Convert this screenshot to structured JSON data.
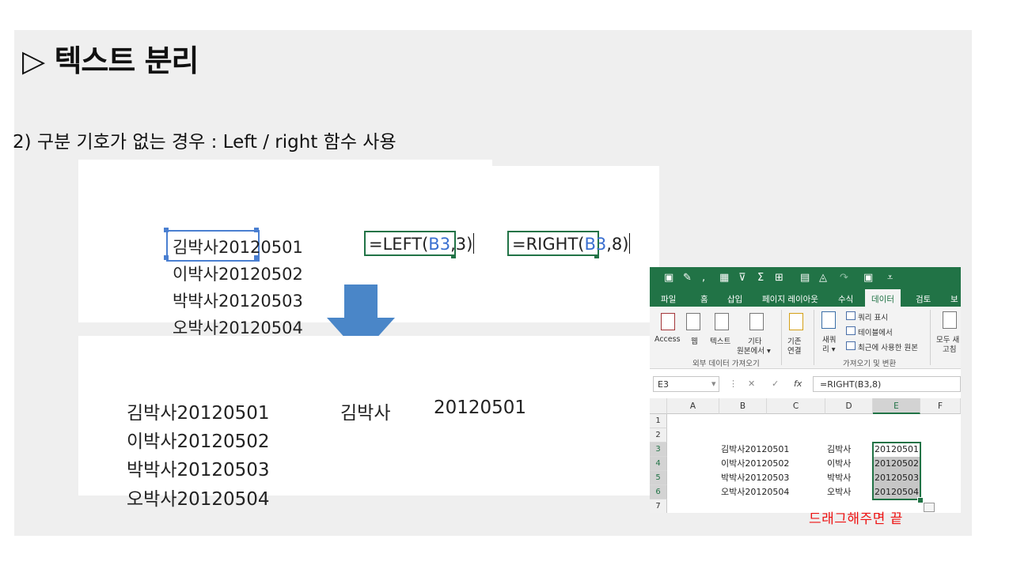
{
  "slide": {
    "title": "▷ 텍스트 분리",
    "subtitle": "2) 구분 기호가 없는 경우 : Left / right 함수 사용"
  },
  "top_panel": {
    "names": [
      "김박사20120501",
      "이박사20120502",
      "박박사20120503",
      "오박사20120504"
    ],
    "left_formula": {
      "prefix": "=LEFT(",
      "ref": "B3",
      "suffix": ",3)"
    },
    "right_formula": {
      "prefix": "=RIGHT(",
      "ref": "B3",
      "suffix": ",8)"
    }
  },
  "bottom_panel": {
    "names": [
      "김박사20120501",
      "이박사20120502",
      "박박사20120503",
      "오박사20120504"
    ],
    "left_result": "김박사",
    "right_result": "20120501"
  },
  "excel": {
    "tabs": [
      "파일",
      "홈",
      "삽입",
      "페이지 레이아웃",
      "수식",
      "데이터",
      "검토",
      "보"
    ],
    "active_tab": "데이터",
    "ribbon": {
      "access": "Access",
      "web": "웹",
      "text": "텍스트",
      "other_line1": "기타",
      "other_line2": "원본에서 ▾",
      "existing_line1": "기존",
      "existing_line2": "연결",
      "group1": "외부 데이터 가져오기",
      "new_query_line1": "새쿼",
      "new_query_line2": "리 ▾",
      "show_query": "쿼리 표시",
      "from_table": "테이블에서",
      "recent_sources": "최근에 사용한 원본",
      "group2": "가져오기 및 변환",
      "refresh_line1": "모두 새",
      "refresh_line2": "고침"
    },
    "name_box": "E3",
    "formula": "=RIGHT(B3,8)",
    "columns": [
      "A",
      "B",
      "C",
      "D",
      "E",
      "F"
    ],
    "rows": [
      "1",
      "2",
      "3",
      "4",
      "5",
      "6",
      "7"
    ],
    "col_b": [
      "김박사20120501",
      "이박사20120502",
      "박박사20120503",
      "오박사20120504"
    ],
    "col_d": [
      "김박사",
      "이박사",
      "박박사",
      "오박사"
    ],
    "col_e": [
      "20120501",
      "20120502",
      "20120503",
      "20120504"
    ],
    "colors": {
      "excel_green": "#217346",
      "caption_red": "#ee1111",
      "arrow_blue": "#4a86c8"
    }
  },
  "caption": "드래그해주면  끝"
}
